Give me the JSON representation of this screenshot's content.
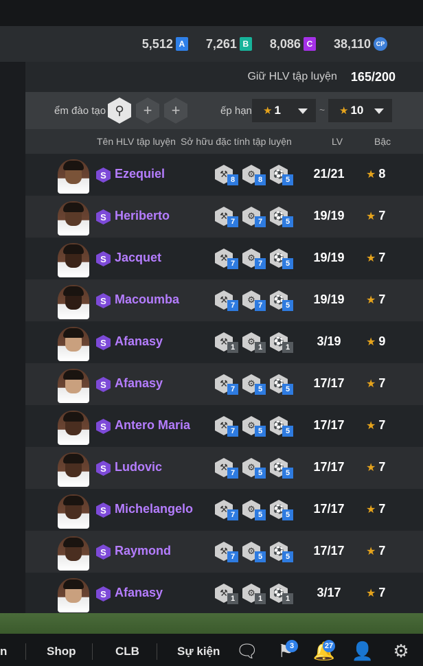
{
  "currencies": [
    {
      "value": "5,512",
      "badge": "A",
      "color": "#2f80e8"
    },
    {
      "value": "7,261",
      "badge": "B",
      "color": "#17b39a"
    },
    {
      "value": "8,086",
      "badge": "C",
      "color": "#a531e8"
    },
    {
      "value": "38,110",
      "badge": "CP",
      "color": "#3d7fd8"
    }
  ],
  "keep": {
    "label": "Giữ HLV tập luyện",
    "value": "165/200"
  },
  "filter": {
    "label": "ểm đào tạo",
    "sort_label": "ếp hạn",
    "from": "1",
    "to": "10",
    "tilde": "~",
    "add": "+"
  },
  "columns": {
    "name": "Tên HLV tập luyện",
    "traits": "Sở hữu đặc tính tập luyện",
    "lv": "LV",
    "grade": "Bậc"
  },
  "rows": [
    {
      "badge": "S",
      "name": "Ezequiel",
      "traits": [
        "8",
        "8",
        "5"
      ],
      "trait_colors": [
        "blue",
        "blue",
        "blue"
      ],
      "lv": "21/21",
      "grade": "8"
    },
    {
      "badge": "S",
      "name": "Heriberto",
      "traits": [
        "7",
        "7",
        "5"
      ],
      "trait_colors": [
        "blue",
        "blue",
        "blue"
      ],
      "lv": "19/19",
      "grade": "7"
    },
    {
      "badge": "S",
      "name": "Jacquet",
      "traits": [
        "7",
        "7",
        "5"
      ],
      "trait_colors": [
        "blue",
        "blue",
        "blue"
      ],
      "lv": "19/19",
      "grade": "7"
    },
    {
      "badge": "S",
      "name": "Macoumba",
      "traits": [
        "7",
        "7",
        "5"
      ],
      "trait_colors": [
        "blue",
        "blue",
        "blue"
      ],
      "lv": "19/19",
      "grade": "7"
    },
    {
      "badge": "S",
      "name": "Afanasy",
      "traits": [
        "1",
        "1",
        "1"
      ],
      "trait_colors": [
        "grey",
        "grey",
        "grey"
      ],
      "lv": "3/19",
      "grade": "9"
    },
    {
      "badge": "S",
      "name": "Afanasy",
      "traits": [
        "7",
        "5",
        "5"
      ],
      "trait_colors": [
        "blue",
        "blue",
        "blue"
      ],
      "lv": "17/17",
      "grade": "7"
    },
    {
      "badge": "S",
      "name": "Antero Maria",
      "traits": [
        "7",
        "5",
        "5"
      ],
      "trait_colors": [
        "blue",
        "blue",
        "blue"
      ],
      "lv": "17/17",
      "grade": "7"
    },
    {
      "badge": "S",
      "name": "Ludovic",
      "traits": [
        "7",
        "5",
        "5"
      ],
      "trait_colors": [
        "blue",
        "blue",
        "blue"
      ],
      "lv": "17/17",
      "grade": "7"
    },
    {
      "badge": "S",
      "name": "Michelangelo",
      "traits": [
        "7",
        "5",
        "5"
      ],
      "trait_colors": [
        "blue",
        "blue",
        "blue"
      ],
      "lv": "17/17",
      "grade": "7"
    },
    {
      "badge": "S",
      "name": "Raymond",
      "traits": [
        "7",
        "5",
        "5"
      ],
      "trait_colors": [
        "blue",
        "blue",
        "blue"
      ],
      "lv": "17/17",
      "grade": "7"
    },
    {
      "badge": "S",
      "name": "Afanasy",
      "traits": [
        "1",
        "1",
        "1"
      ],
      "trait_colors": [
        "grey",
        "grey",
        "grey"
      ],
      "lv": "3/17",
      "grade": "7"
    }
  ],
  "nav": {
    "partial": "n",
    "shop": "Shop",
    "clb": "CLB",
    "event": "Sự kiện",
    "flag_badge": "3",
    "bell_badge": "27"
  },
  "icons": [
    "chat-icon",
    "flag-icon",
    "bell-icon",
    "profile-icon",
    "gear-icon",
    "whistle-icon",
    "star-icon",
    "chevron-down-icon"
  ]
}
